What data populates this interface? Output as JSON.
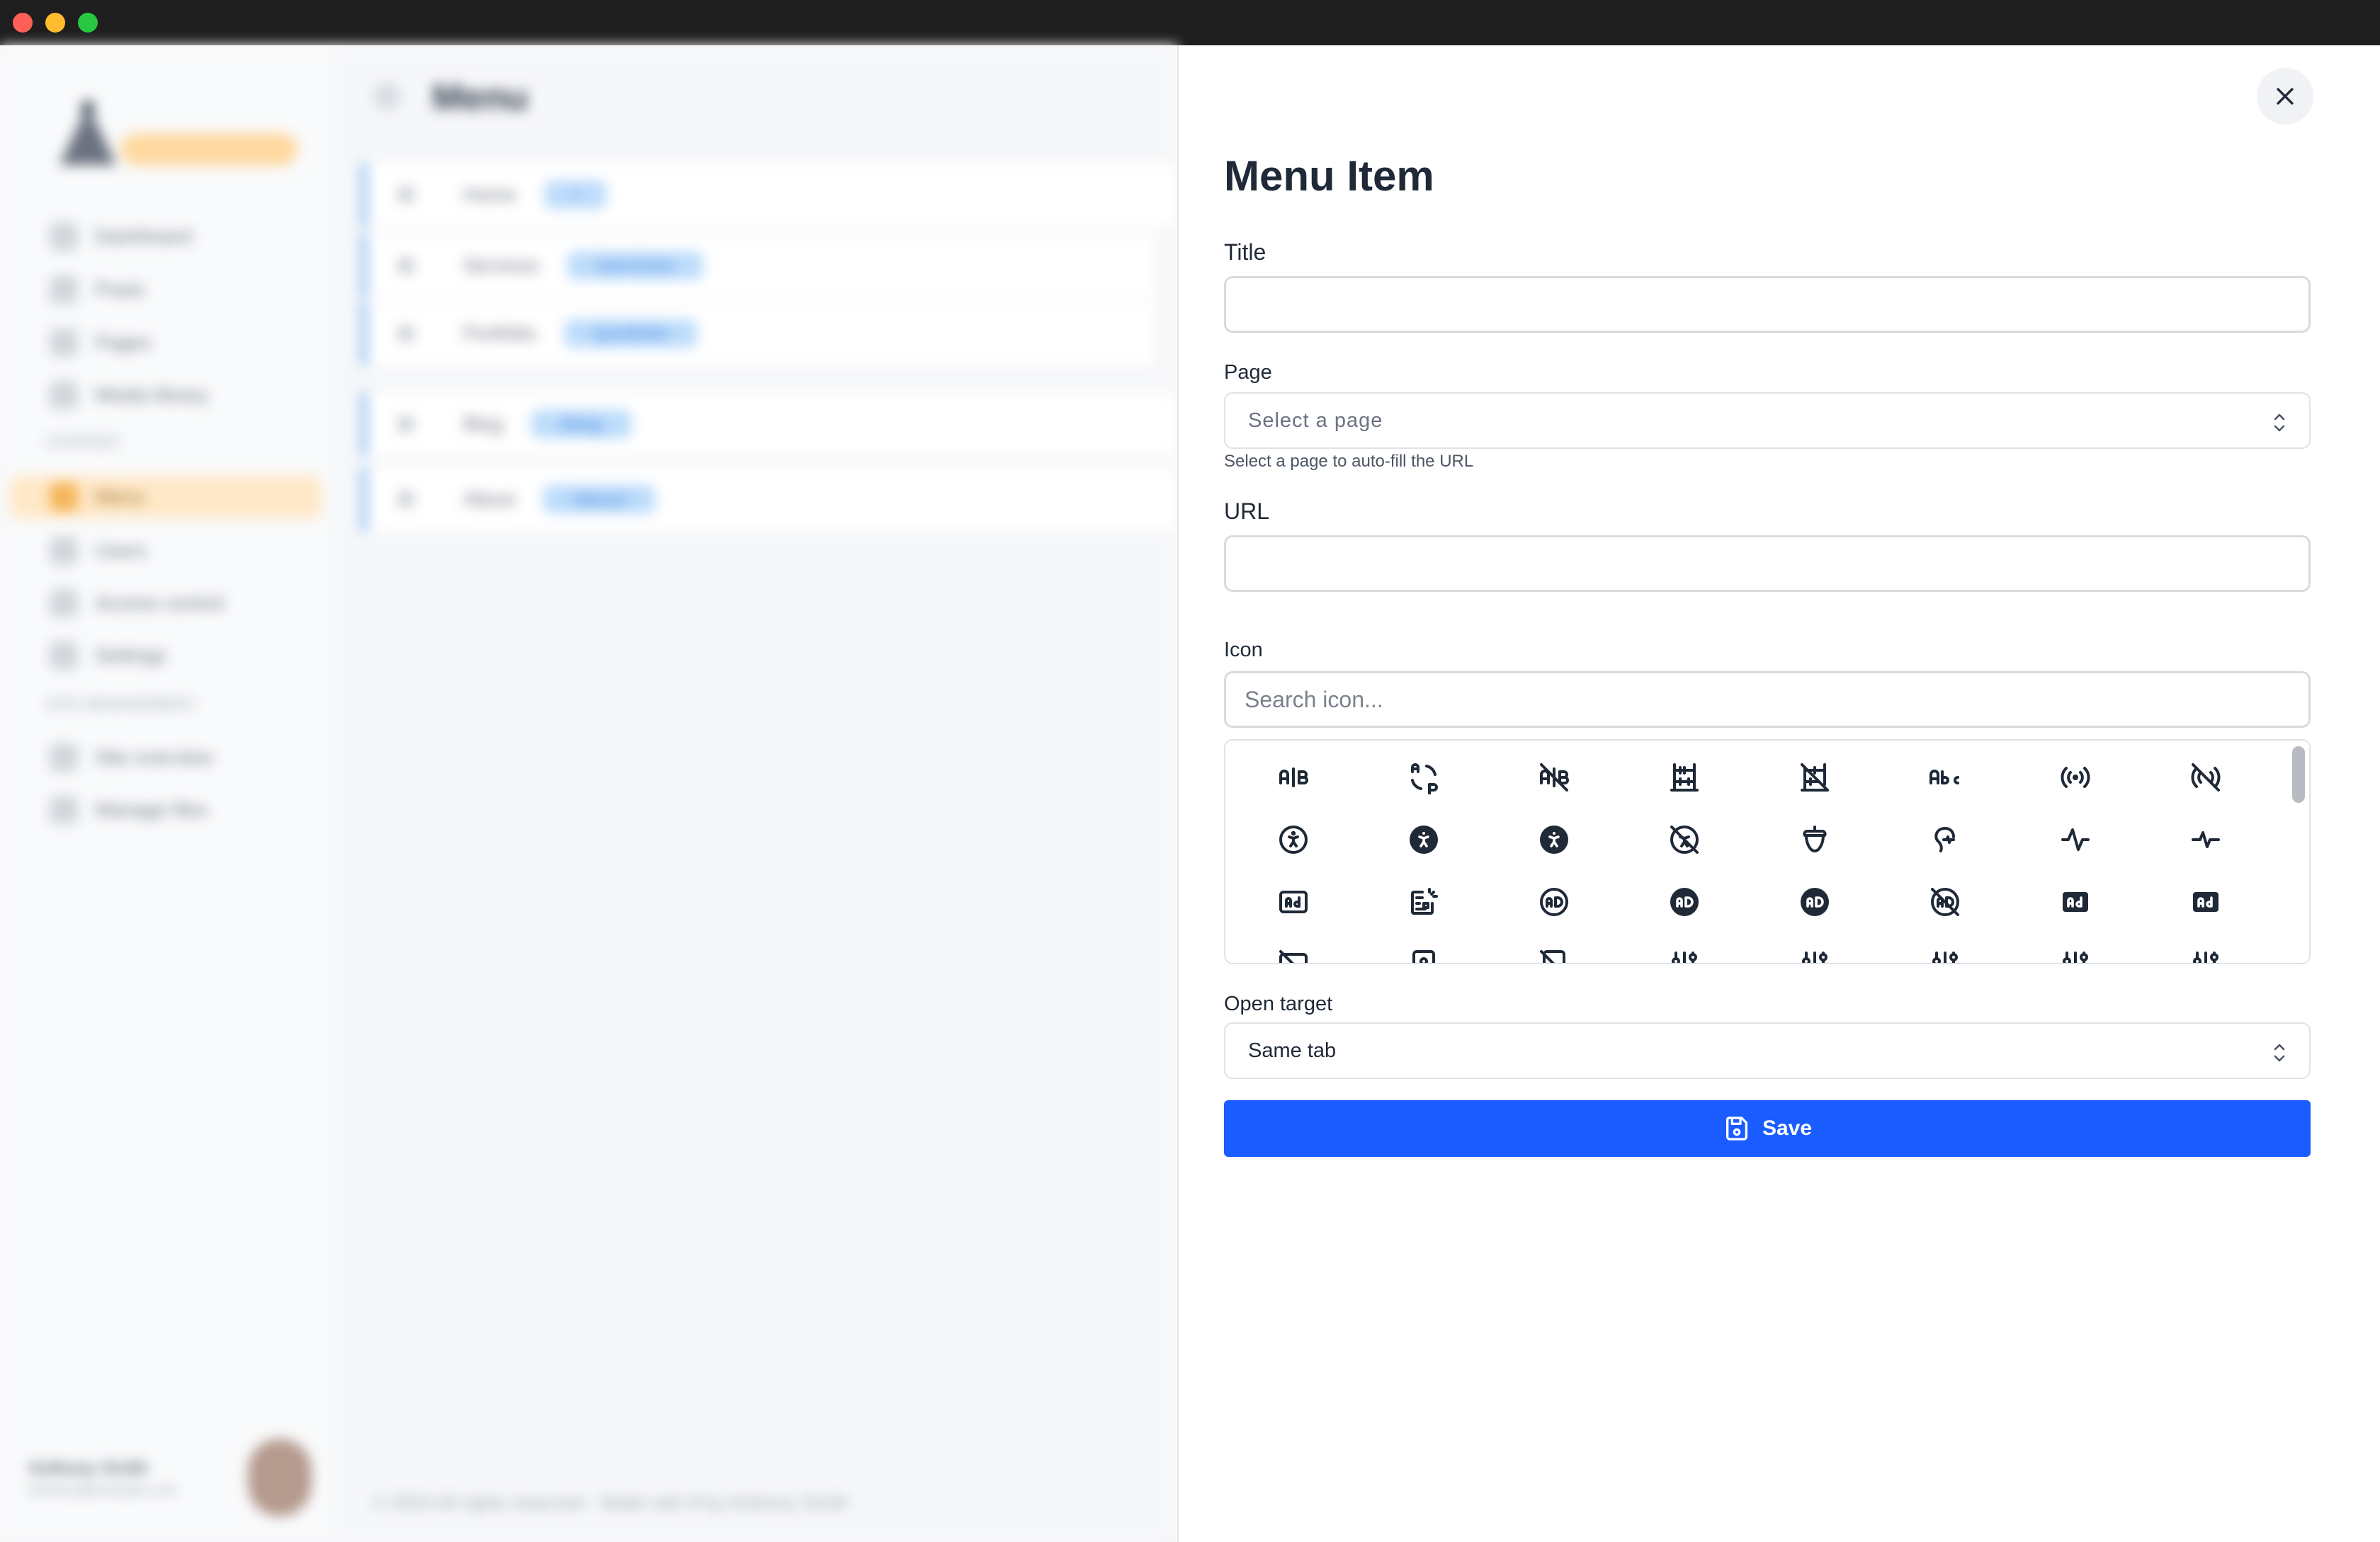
{
  "sidebar": {
    "items": [
      {
        "label": "Dashboard"
      },
      {
        "label": "Posts"
      },
      {
        "label": "Pages"
      },
      {
        "label": "Media library"
      },
      {
        "label": "Menu"
      },
      {
        "label": "Users"
      },
      {
        "label": "Access control"
      },
      {
        "label": "Settings"
      },
      {
        "label": "Site overview"
      },
      {
        "label": "Manage files"
      }
    ],
    "headings": [
      "Content",
      "Site management"
    ],
    "profile": {
      "name": "Anthony Smith",
      "email": "anthony@example.com"
    }
  },
  "content": {
    "title": "Menu",
    "rows": [
      {
        "label": "Home",
        "tag": "/"
      },
      {
        "label": "Services",
        "tag": "/services"
      },
      {
        "label": "Portfolio",
        "tag": "/portfolio"
      },
      {
        "label": "Blog",
        "tag": "/blog"
      },
      {
        "label": "About",
        "tag": "/about"
      }
    ],
    "footer": "© 2024 All rights reserved · Made with ♥ by Anthony Smith"
  },
  "panel": {
    "title": "Menu Item",
    "title_label": "Title",
    "title_value": "",
    "page_label": "Page",
    "page_placeholder": "Select a page",
    "page_hint": "Select a page to auto-fill the URL",
    "url_label": "URL",
    "url_value": "",
    "icon_label": "Icon",
    "icon_search_placeholder": "Search icon...",
    "open_target_label": "Open target",
    "open_target_value": "Same tab",
    "save_label": "Save"
  },
  "icons": [
    "a-b-icon",
    "a-b-2-icon",
    "a-b-off-icon",
    "abacus-icon",
    "abacus-off-icon",
    "abc-icon",
    "access-point-icon",
    "access-point-off-icon",
    "accessible-icon",
    "accessible-filled-icon",
    "accessible-circle-filled-icon",
    "accessible-off-icon",
    "acorn-icon",
    "activity-heartbeat-icon",
    "activity-icon",
    "activity-2-icon",
    "ad-icon",
    "ad-2-icon",
    "ad-circle-icon",
    "ad-circle-filled-icon",
    "ad-circle-filled-2-icon",
    "ad-circle-off-icon",
    "ad-filled-icon",
    "ad-filled-2-icon",
    "ad-off-icon",
    "address-book-icon",
    "address-book-off-icon",
    "adjustments-icon",
    "adjustments-alt-icon",
    "adjustments-bolt-icon",
    "adjustments-cancel-icon",
    "adjustments-check-icon"
  ],
  "colors": {
    "primary": "#1a5cff",
    "text": "#1f2937",
    "border": "#d7dbe0",
    "accent_orange": "#f5b55a"
  }
}
